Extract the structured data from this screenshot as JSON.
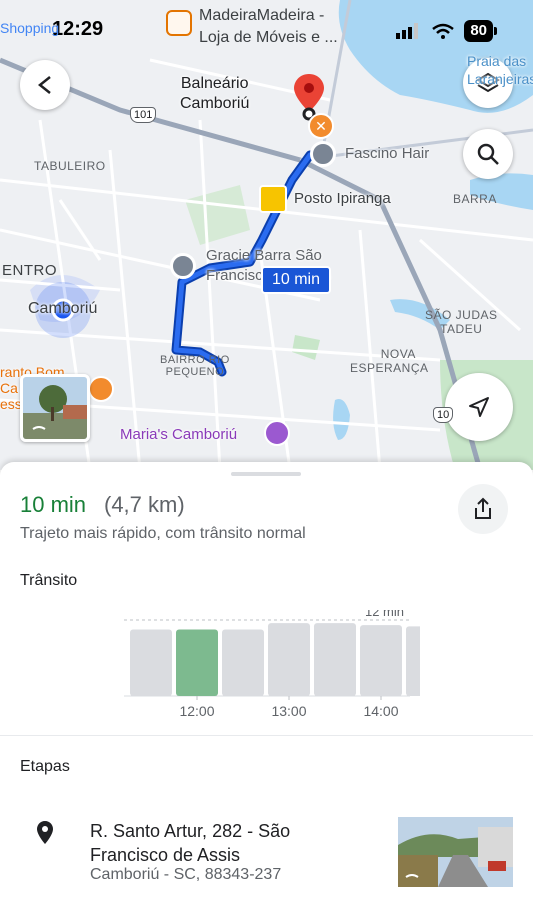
{
  "status_bar": {
    "time": "12:29",
    "battery": "80",
    "notification_title": "MadeiraMadeira -",
    "notification_sub": "Loja de Móveis e ...",
    "back_app": "Shopping"
  },
  "map": {
    "city_label_line1": "Balneário",
    "city_label_line2": "Camboriú",
    "areas": {
      "tabuleiro": "TABULEIRO",
      "centro": "ENTRO",
      "barra": "BARRA",
      "sao_judas_1": "SÃO JUDAS",
      "sao_judas_2": "TADEU",
      "nova_esp_1": "NOVA",
      "nova_esp_2": "ESPERANÇA",
      "bairro_rio_1": "BAIRRO RIO",
      "bairro_rio_2": "PEQUENO"
    },
    "pois": {
      "fascino": "Fascino Hair",
      "posto": "Posto Ipiranga",
      "gracie_1": "Gracie Barra São",
      "gracie_2": "Francisco de Assis",
      "marias": "Maria's Camboriú",
      "origin": "Camboriú",
      "praia_1": "Praia das",
      "praia_2": "Laranjeiras",
      "left_poi_1": "ranto Bom",
      "left_poi_2": "Ca",
      "left_poi_3": "ess"
    },
    "road_shields": {
      "br101": "101",
      "br101b": "10"
    },
    "route_time": "10 min",
    "colors": {
      "route": "#1a56d6",
      "water": "#a8d6f3",
      "park": "#c8e6c9"
    }
  },
  "summary": {
    "duration": "10 min",
    "distance": "(4,7 km)",
    "subtitle": "Trajeto mais rápido, com trânsito normal"
  },
  "traffic": {
    "title": "Trânsito",
    "max_label": "12 min"
  },
  "chart_data": {
    "type": "bar",
    "title": "Trânsito",
    "categories": [
      "11:30",
      "12:00",
      "12:30",
      "13:00",
      "13:30",
      "14:00",
      "14:30"
    ],
    "tick_labels": [
      "12:00",
      "13:00",
      "14:00"
    ],
    "values": [
      10.5,
      10.5,
      10.5,
      11.5,
      11.5,
      11.2,
      11
    ],
    "highlight_index": 1,
    "ylim": [
      0,
      12
    ],
    "reference_line": 12,
    "reference_label": "12 min",
    "colors": {
      "bar": "#dadce0",
      "highlight": "#7dba8f"
    }
  },
  "steps": {
    "title": "Etapas",
    "address_line1": "R. Santo Artur, 282 - São",
    "address_line2": "Francisco de Assis",
    "city": "Camboriú - SC, 88343-237"
  }
}
